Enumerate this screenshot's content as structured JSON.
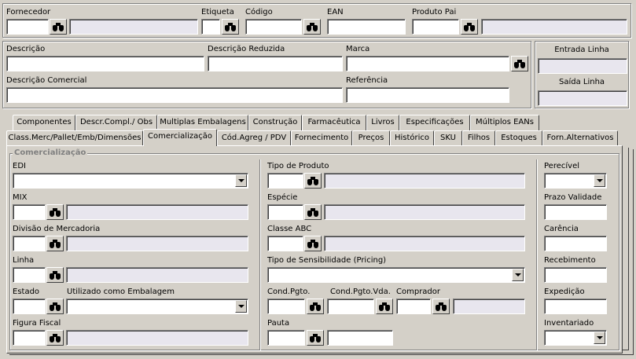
{
  "header": {
    "fornecedor": {
      "label": "Fornecedor",
      "value": "",
      "name": ""
    },
    "etiqueta": {
      "label": "Etiqueta",
      "value": ""
    },
    "codigo": {
      "label": "Código",
      "value": ""
    },
    "ean": {
      "label": "EAN",
      "value": ""
    },
    "produto_pai": {
      "label": "Produto Pai",
      "value": "",
      "name": ""
    }
  },
  "desc": {
    "descricao": {
      "label": "Descrição",
      "value": ""
    },
    "descricao_reduzida": {
      "label": "Descrição Reduzida",
      "value": ""
    },
    "marca": {
      "label": "Marca",
      "value": ""
    },
    "descricao_comercial": {
      "label": "Descrição Comercial",
      "value": ""
    },
    "referencia": {
      "label": "Referência",
      "value": ""
    }
  },
  "side_buttons": {
    "entrada_linha": "Entrada Linha",
    "saida_linha": "Saída Linha"
  },
  "tabs_row1": [
    "Componentes",
    "Descr.Compl./ Obs",
    "Multiplas Embalagens",
    "Construção",
    "Farmacêutica",
    "Livros",
    "Especificações",
    "Múltiplos EANs"
  ],
  "tabs_row2": [
    "Class.Merc/Pallet/Emb/Dimensões",
    "Comercialização",
    "Cód.Agreg / PDV",
    "Fornecimento",
    "Preços",
    "Histórico",
    "SKU",
    "Filhos",
    "Estoques",
    "Forn.Alternativos"
  ],
  "group_title": "Comercialização",
  "col1": {
    "edi": {
      "label": "EDI",
      "value": ""
    },
    "mix": {
      "label": "MIX",
      "value": ""
    },
    "divisao": {
      "label": "Divisão de Mercadoria",
      "value": ""
    },
    "linha": {
      "label": "Linha",
      "value": ""
    },
    "estado": {
      "label": "Estado",
      "value": ""
    },
    "utilizado": {
      "label": "Utilizado como Embalagem",
      "value": ""
    },
    "figura_fiscal": {
      "label": "Figura Fiscal",
      "value": ""
    }
  },
  "col2": {
    "tipo_produto": {
      "label": "Tipo de Produto",
      "value": ""
    },
    "especie": {
      "label": "Espécie",
      "value": ""
    },
    "classe_abc": {
      "label": "Classe ABC",
      "value": ""
    },
    "tipo_sensibilidade": {
      "label": "Tipo de Sensibilidade (Pricing)",
      "value": ""
    },
    "cond_pgto": {
      "label": "Cond.Pgto.",
      "value": ""
    },
    "cond_pgto_vda": {
      "label": "Cond.Pgto.Vda.",
      "value": ""
    },
    "comprador": {
      "label": "Comprador",
      "value": ""
    },
    "pauta": {
      "label": "Pauta",
      "value": ""
    }
  },
  "col3": {
    "perecivel": {
      "label": "Perecível",
      "value": ""
    },
    "prazo_validade": {
      "label": "Prazo Validade",
      "value": ""
    },
    "carencia": {
      "label": "Carência",
      "value": ""
    },
    "recebimento": {
      "label": "Recebimento",
      "value": ""
    },
    "expedicao": {
      "label": "Expedição",
      "value": ""
    },
    "inventariado": {
      "label": "Inventariado",
      "value": ""
    }
  }
}
